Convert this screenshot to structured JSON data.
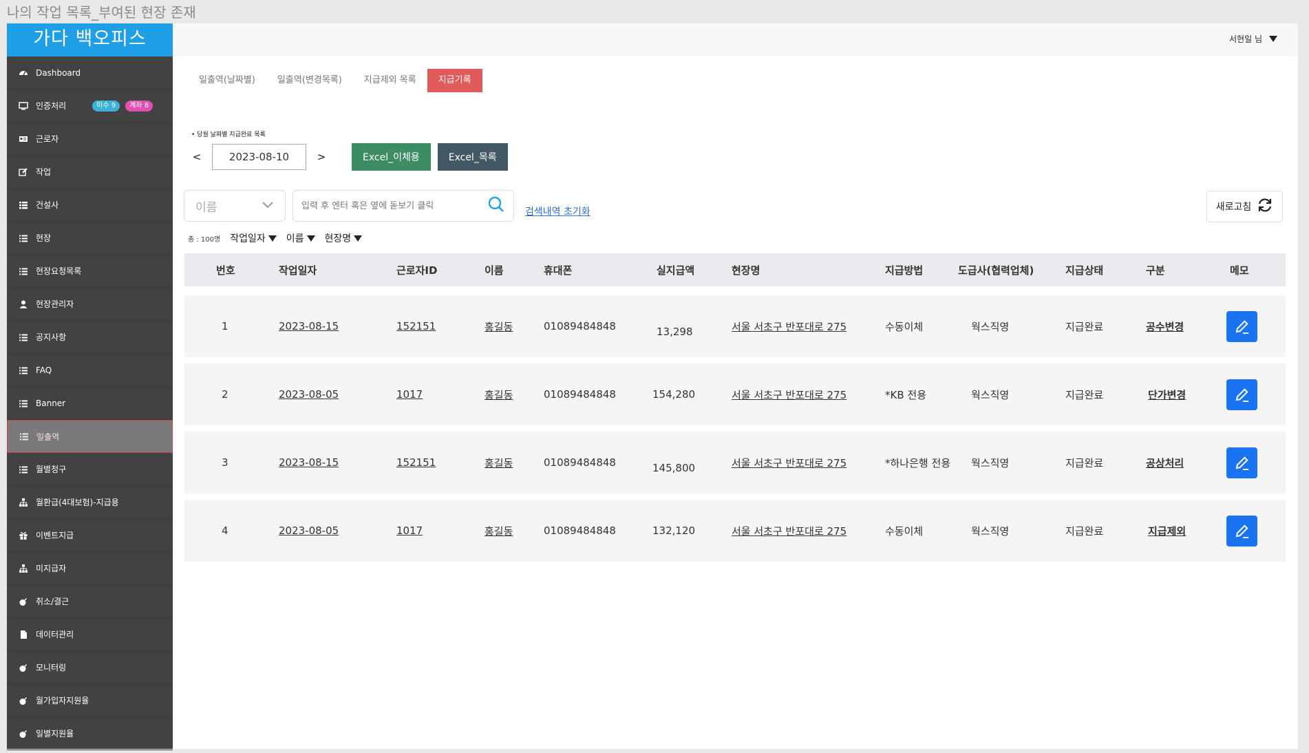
{
  "frame_title": "나의 작업 목록_부여된 현장 존재",
  "sidebar": {
    "brand": "가다 백오피스",
    "items": [
      {
        "label": "Dashboard",
        "icon": "dashboard-icon"
      },
      {
        "label": "인증처리",
        "icon": "monitor-icon",
        "badges": [
          "이수 9",
          "계좌 8"
        ]
      },
      {
        "label": "근로자",
        "icon": "id-card-icon"
      },
      {
        "label": "작업",
        "icon": "edit-icon"
      },
      {
        "label": "건설사",
        "icon": "grid-list-icon"
      },
      {
        "label": "현장",
        "icon": "list-icon"
      },
      {
        "label": "현장요청목록",
        "icon": "list-icon"
      },
      {
        "label": "현장관리자",
        "icon": "user-icon"
      },
      {
        "label": "공지사항",
        "icon": "list-icon"
      },
      {
        "label": "FAQ",
        "icon": "list-icon"
      },
      {
        "label": "Banner",
        "icon": "list-icon"
      },
      {
        "label": "일출역",
        "icon": "list-icon",
        "active": true
      },
      {
        "label": "월별청구",
        "icon": "list-icon"
      },
      {
        "label": "월환급(4대보험)-지급용",
        "icon": "sitemap-icon"
      },
      {
        "label": "이벤트지급",
        "icon": "gift-icon"
      },
      {
        "label": "미지급자",
        "icon": "sitemap-icon"
      },
      {
        "label": "취소/결근",
        "icon": "bomb-icon"
      },
      {
        "label": "데이터관리",
        "icon": "file-icon"
      },
      {
        "label": "모니터링",
        "icon": "bomb-icon"
      },
      {
        "label": "월가입자지원율",
        "icon": "bomb-icon"
      },
      {
        "label": "일별지원율",
        "icon": "bomb-icon"
      }
    ]
  },
  "topbar": {
    "user": "서현일 님"
  },
  "tabs": [
    {
      "label": "일출역(날짜별)",
      "active": false
    },
    {
      "label": "일출역(변경목록)",
      "active": false
    },
    {
      "label": "지급제외 목록",
      "active": false
    },
    {
      "label": "지급기록",
      "active": true
    }
  ],
  "note": "• 당월 날짜별 지급완료 목록",
  "date_nav": {
    "prev": "<",
    "date": "2023-08-10",
    "next": ">"
  },
  "buttons": {
    "excel_transfer": "Excel_이체용",
    "excel_list": "Excel_목록",
    "refresh": "새로고침"
  },
  "search": {
    "select_value": "이름",
    "placeholder": "입력 후 엔터 혹은 옆에 돋보기 클릭",
    "reset": "검색내역 초기화"
  },
  "sort": {
    "total": "총 : 100명",
    "fields": [
      "작업일자",
      "이름",
      "현장명"
    ]
  },
  "table": {
    "columns": [
      "번호",
      "작업일자",
      "근로자ID",
      "이름",
      "휴대폰",
      "실지급액",
      "현장명",
      "지급방법",
      "도급사(협력업체)",
      "지급상태",
      "구분",
      "메모"
    ],
    "rows": [
      {
        "no": "1",
        "date": "2023-08-15",
        "worker_id": "152151",
        "name": "홍길동",
        "phone": "01089484848",
        "amount": "13,298",
        "site": "서울 서초구 반포대로 275",
        "method": "수동이체",
        "contractor": "웍스직영",
        "status": "지급완료",
        "kind": "공수변경"
      },
      {
        "no": "2",
        "date": "2023-08-05",
        "worker_id": "1017",
        "name": "홍길동",
        "phone": "01089484848",
        "amount": "154,280",
        "site": "서울 서초구 반포대로 275",
        "method": "*KB 전용",
        "contractor": "웍스직영",
        "status": "지급완료",
        "kind": "단가변경"
      },
      {
        "no": "3",
        "date": "2023-08-15",
        "worker_id": "152151",
        "name": "홍길동",
        "phone": "01089484848",
        "amount": "145,800",
        "site": "서울 서초구 반포대로 275",
        "method": "*하나은행 전용",
        "contractor": "웍스직영",
        "status": "지급완료",
        "kind": "공상처리"
      },
      {
        "no": "4",
        "date": "2023-08-05",
        "worker_id": "1017",
        "name": "홍길동",
        "phone": "01089484848",
        "amount": "132,120",
        "site": "서울 서초구 반포대로 275",
        "method": "수동이체",
        "contractor": "웍스직영",
        "status": "지급완료",
        "kind": "지급제외"
      }
    ]
  },
  "colors": {
    "brand": "#1e9fe6",
    "active_tab": "#e05a5a",
    "excel_green": "#3c8d63",
    "excel_slate": "#425865",
    "memo_blue": "#1a73f0",
    "badge_blue": "#3bb2d6",
    "badge_pink": "#e44fb3"
  }
}
